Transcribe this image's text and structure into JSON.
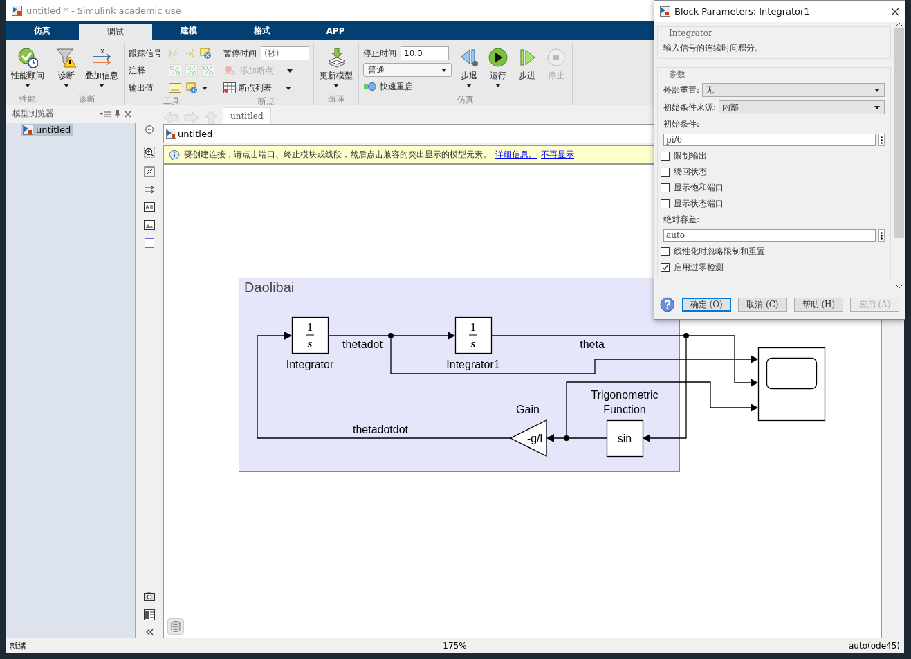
{
  "window": {
    "title": "untitled * - Simulink academic use"
  },
  "tabs": [
    {
      "label": "仿真",
      "selected": false
    },
    {
      "label": "调试",
      "selected": true
    },
    {
      "label": "建模",
      "selected": false
    },
    {
      "label": "格式",
      "selected": false
    },
    {
      "label": "APP",
      "selected": false
    }
  ],
  "ribbon": {
    "groups": [
      {
        "label": "性能",
        "items": [
          {
            "kind": "large",
            "label": "性能顾问",
            "dropdown": true,
            "disabled": false
          }
        ]
      },
      {
        "label": "诊断",
        "items": [
          {
            "kind": "large",
            "label": "诊断",
            "dropdown": true,
            "disabled": false
          },
          {
            "kind": "large",
            "label": "叠加信息",
            "dropdown": true,
            "disabled": false
          }
        ]
      },
      {
        "label": "工具",
        "items": [
          {
            "kind": "tool-row",
            "label": "跟踪信号"
          },
          {
            "kind": "tool-row",
            "label": "注释"
          },
          {
            "kind": "tool-row",
            "label": "输出值"
          }
        ]
      },
      {
        "label": "断点",
        "items": [
          {
            "kind": "field",
            "label": "暂停时间",
            "placeholder": "(秒)"
          },
          {
            "kind": "small",
            "label": "添加断点",
            "dropdown": true,
            "disabled": true
          },
          {
            "kind": "small",
            "label": "断点列表",
            "dropdown": true,
            "disabled": false
          }
        ]
      },
      {
        "label": "编译",
        "items": [
          {
            "kind": "large",
            "label": "更新模型",
            "dropdown": true,
            "disabled": false
          }
        ]
      },
      {
        "label": "仿真",
        "items": [
          {
            "kind": "field",
            "label": "停止时间",
            "value": "10.0"
          },
          {
            "kind": "select",
            "value": "普通"
          },
          {
            "kind": "small",
            "label": "快速重启",
            "dropdown": false,
            "disabled": false
          },
          {
            "kind": "large",
            "label": "步退",
            "dropdown": true,
            "disabled": false
          },
          {
            "kind": "large",
            "label": "运行",
            "dropdown": true,
            "disabled": false
          },
          {
            "kind": "large",
            "label": "步进",
            "dropdown": false,
            "disabled": false
          },
          {
            "kind": "large",
            "label": "停止",
            "dropdown": false,
            "disabled": true
          }
        ]
      }
    ]
  },
  "browser": {
    "title": "模型浏览器",
    "items": [
      {
        "label": "untitled",
        "selected": true
      }
    ]
  },
  "editor": {
    "tabs": [
      {
        "label": "untitled",
        "selected": true
      }
    ],
    "breadcrumb": "untitled",
    "info": {
      "text": "要创建连接，请点击端口、终止模块或线段，然后点击兼容的突出显示的模型元素。",
      "links": [
        "详细信息。",
        "不再显示"
      ]
    }
  },
  "diagram": {
    "subsystem": {
      "title": "Daolibai"
    },
    "blocks": [
      {
        "kind": "integrator",
        "numerator": "1",
        "denominator": "s",
        "label": [
          "Integrator"
        ]
      },
      {
        "kind": "integrator",
        "numerator": "1",
        "denominator": "s",
        "label": [
          "Integrator1"
        ]
      },
      {
        "kind": "gain",
        "value": "-g/l",
        "label": [
          "Gain"
        ]
      },
      {
        "kind": "function",
        "value": "sin",
        "label": [
          "Trigonometric",
          "Function"
        ]
      },
      {
        "kind": "scope"
      }
    ],
    "signals": [
      {
        "label": "thetadot"
      },
      {
        "label": "theta"
      },
      {
        "label": "thetadotdot"
      }
    ]
  },
  "status_bar": {
    "state": "就绪",
    "zoom": "175%",
    "solver": "auto(ode45)"
  },
  "dialog": {
    "title": "Block Parameters: Integrator1",
    "block_type": "Integrator",
    "description": "输入信号的连续时间积分。",
    "params_title": "参数",
    "params": [
      {
        "kind": "select",
        "label": "外部重置:",
        "value": "无"
      },
      {
        "kind": "select",
        "label": "初始条件来源:",
        "value": "内部"
      },
      {
        "kind": "edit",
        "label": "初始条件:",
        "value": "pi/6"
      },
      {
        "kind": "checkbox",
        "label": "限制输出",
        "checked": false
      },
      {
        "kind": "checkbox",
        "label": "绕回状态",
        "checked": false
      },
      {
        "kind": "checkbox",
        "label": "显示饱和端口",
        "checked": false
      },
      {
        "kind": "checkbox",
        "label": "显示状态端口",
        "checked": false
      },
      {
        "kind": "edit",
        "label": "绝对容差:",
        "value": "auto"
      },
      {
        "kind": "checkbox",
        "label": "线性化时忽略限制和重置",
        "checked": false
      },
      {
        "kind": "checkbox",
        "label": "启用过零检测",
        "checked": true
      }
    ],
    "buttons": [
      {
        "label": "确定 (O)",
        "default": true,
        "disabled": false
      },
      {
        "label": "取消 (C)",
        "default": false,
        "disabled": false
      },
      {
        "label": "帮助 (H)",
        "default": false,
        "disabled": false
      },
      {
        "label": "应用 (A)",
        "default": false,
        "disabled": true
      }
    ]
  }
}
